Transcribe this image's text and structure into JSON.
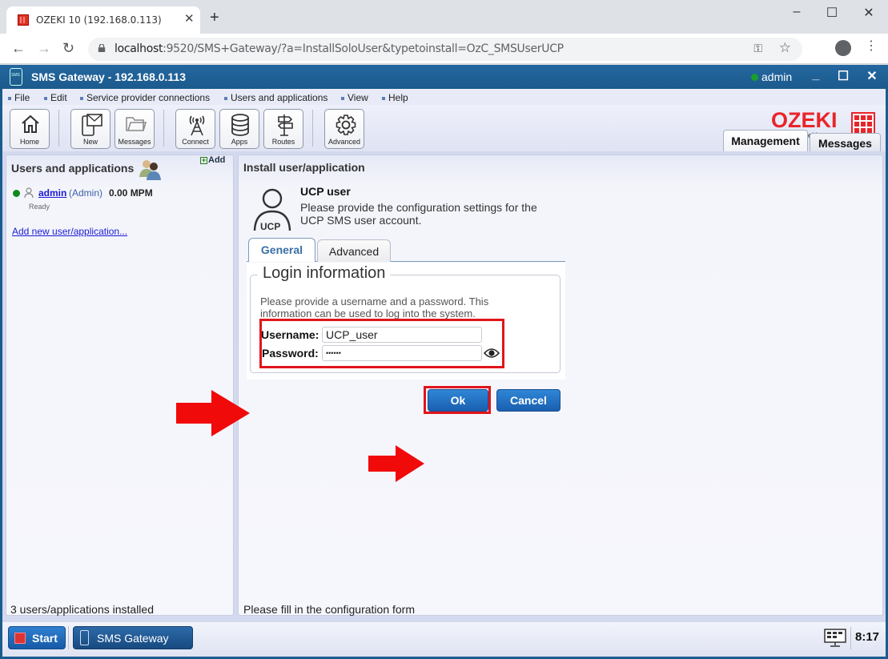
{
  "browser": {
    "tab_title": "OZEKI 10 (192.168.0.113)",
    "url_host": "localhost",
    "url_rest": ":9520/SMS+Gateway/?a=InstallSoloUser&typetoinstall=OzC_SMSUserUCP"
  },
  "app": {
    "title": "SMS Gateway - 192.168.0.113",
    "user": "admin",
    "status_color": "#1a9d2c"
  },
  "menu": [
    "File",
    "Edit",
    "Service provider connections",
    "Users and applications",
    "View",
    "Help"
  ],
  "ribbon": {
    "home": "Home",
    "new": "New",
    "messages": "Messages",
    "connect": "Connect",
    "apps": "Apps",
    "routes": "Routes",
    "advanced": "Advanced"
  },
  "logo": {
    "name": "OZEKI",
    "url_pre": "www.",
    "url_my": "my",
    "url_post": "ozeki.com"
  },
  "main_tabs": {
    "management": "Management",
    "messages": "Messages"
  },
  "left_panel": {
    "title": "Users and applications",
    "add_label": "Add",
    "user": {
      "name": "admin",
      "role": "(Admin)",
      "rate": "0.00 MPM",
      "status": "Ready"
    },
    "add_new_link": "Add new user/application...",
    "footer": "3 users/applications installed"
  },
  "right_panel": {
    "title": "Install user/application",
    "icon_label": "UCP",
    "heading": "UCP user",
    "description_line1": "Please provide the configuration settings for the",
    "description_line2": "UCP SMS user account.",
    "tabs": {
      "general": "General",
      "advanced": "Advanced"
    },
    "fieldset": {
      "legend": "Login information",
      "help_line1": "Please provide a username and a password. This",
      "help_line2": "information can be used to log into the system.",
      "username_label": "Username:",
      "username_value": "UCP_user",
      "password_label": "Password:",
      "password_value": "••••••"
    },
    "ok_label": "Ok",
    "cancel_label": "Cancel",
    "footer": "Please fill in the configuration form"
  },
  "taskbar": {
    "start": "Start",
    "app": "SMS Gateway",
    "clock": "8:17"
  }
}
